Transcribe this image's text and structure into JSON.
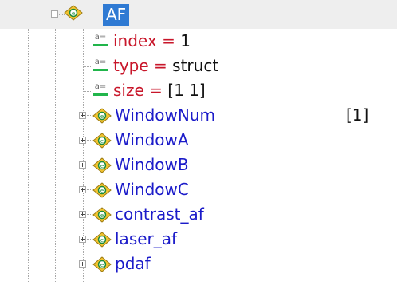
{
  "tree": {
    "root": {
      "label": "AF",
      "icon": "struct-node-icon",
      "expanded": true
    },
    "attributes": [
      {
        "name": "index",
        "eq": " = ",
        "value": "1"
      },
      {
        "name": "type",
        "eq": " = ",
        "value": "struct"
      },
      {
        "name": "size",
        "eq": " = ",
        "value": "[1 1]"
      }
    ],
    "children": [
      {
        "label": "WindowNum",
        "value": "[1]"
      },
      {
        "label": "WindowA",
        "value": ""
      },
      {
        "label": "WindowB",
        "value": ""
      },
      {
        "label": "WindowC",
        "value": ""
      },
      {
        "label": "contrast_af",
        "value": ""
      },
      {
        "label": "laser_af",
        "value": ""
      },
      {
        "label": "pdaf",
        "value": ""
      }
    ],
    "attr_icon_text": "a=",
    "colors": {
      "selection": "#2f7ad3",
      "child_text": "#1b1bc9",
      "attr_name": "#c8162a",
      "attr_bar": "#21b54b",
      "row_highlight": "#eeeeee"
    }
  }
}
